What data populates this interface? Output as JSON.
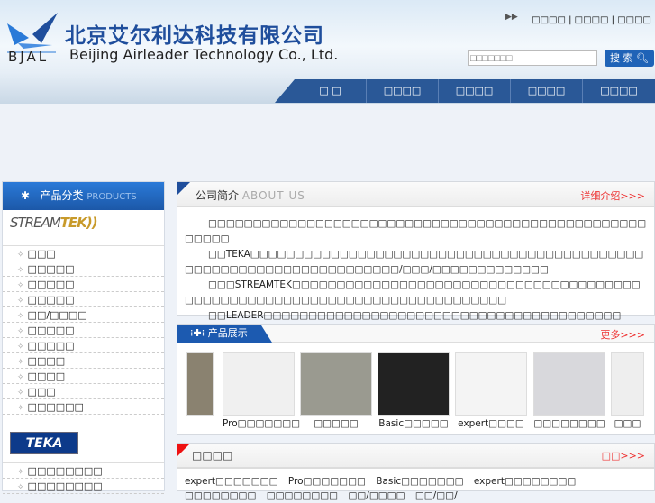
{
  "header": {
    "company_cn": "北京艾尔利达科技有限公司",
    "company_en": "Beijing Airleader Technology Co., Ltd.",
    "logo_abbr": "BJAL",
    "top_links": "□□□□ | □□□□ | □□□□",
    "search_placeholder": "□□□□□□□",
    "search_button": "搜 索"
  },
  "nav": [
    "□ □",
    "□□□□",
    "□□□□",
    "□□□□",
    "□□□□"
  ],
  "sidebar": {
    "title": "产品分类",
    "title_en": "PRODUCTS",
    "brand1": "STREAMTEK",
    "brand2": "TEKA",
    "cats1": [
      "□□□",
      "□□□□□",
      "□□□□□",
      "□□□□□",
      "□□/□□□□",
      "□□□□□",
      "□□□□□",
      "□□□□",
      "□□□□",
      "□□□",
      "□□□□□□"
    ],
    "cats2": [
      "□□□□□□□□",
      "□□□□□□□□"
    ]
  },
  "about": {
    "title": "公司简介",
    "title_en": "ABOUT US",
    "more": "详细介绍>>>",
    "paras": [
      "□□□□□□□□□□□□□□□□□□□□□□□□□□□□□□□□□□□□□□□□□□□□□□□□□□□□□□",
      "□□TEKA□□□□□□□□□□□□□□□□□□□□□□□□□□□□□□□□□□□□□□□□□□□□□□□□□□□□□□□□□□□□□□□□□□□□/□□□/□□□□□□□□□□□□□",
      "□□□STREAMTEK□□□□□□□□□□□□□□□□□□□□□□□□□□□□□□□□□□□□□□□□□□□□□□□□□□□□□□□□□□□□□□□□□□□□□□□□□□□",
      "□□LEADER□□□□□□□□□□□□□□□□□□□□□□□□□□□□□□□□□□□□□□□□"
    ]
  },
  "products": {
    "title": "产品展示",
    "more": "更多>>>",
    "items": [
      "",
      "Pro□□□□□□□",
      "□□□□□",
      "Basic□□□□□",
      "expert□□□□",
      "□□□□□□□□",
      "□□□"
    ]
  },
  "news": {
    "title": "□□□□",
    "more": "□□>>>",
    "items": [
      "expert□□□□□□□",
      "Pro□□□□□□□",
      "Basic□□□□□□□",
      "expert□□□□□□□□",
      "□□□□□□□□",
      "□□□□□□□□",
      "□□/□□□□",
      "□□/□□/"
    ]
  }
}
